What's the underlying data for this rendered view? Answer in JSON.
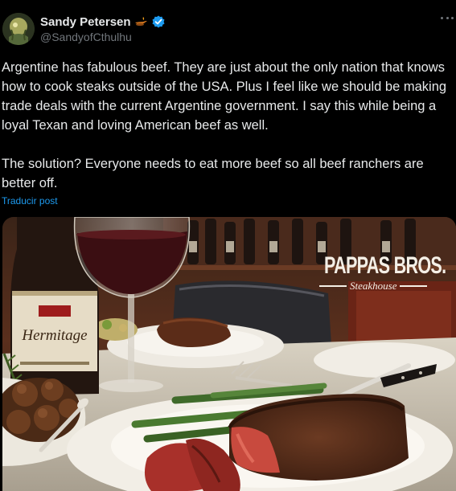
{
  "author": {
    "display_name": "Sandy Petersen",
    "handle": "@SandyofCthulhu",
    "name_icon": "oil-lamp-icon",
    "badge": "verified-badge-icon"
  },
  "post": {
    "text": "Argentine has fabulous beef. They are just about the only nation that knows how to cook steaks outside of the USA. Plus I feel like we should be making trade deals with the current Argentine government. I say this while being a loyal Texan and loving American beef as well.\n\nThe solution? Everyone needs to eat more beef so all beef ranchers are better off.",
    "translate_label": "Traducir post"
  },
  "media": {
    "brand_name": "PAPPAS BROS.",
    "brand_sub": "Steakhouse",
    "bottle_label": "Hermitage"
  },
  "colors": {
    "background": "#000000",
    "text": "#e7e9ea",
    "secondary": "#71767b",
    "link": "#1d9bf0",
    "verified": "#1d9bf0"
  }
}
